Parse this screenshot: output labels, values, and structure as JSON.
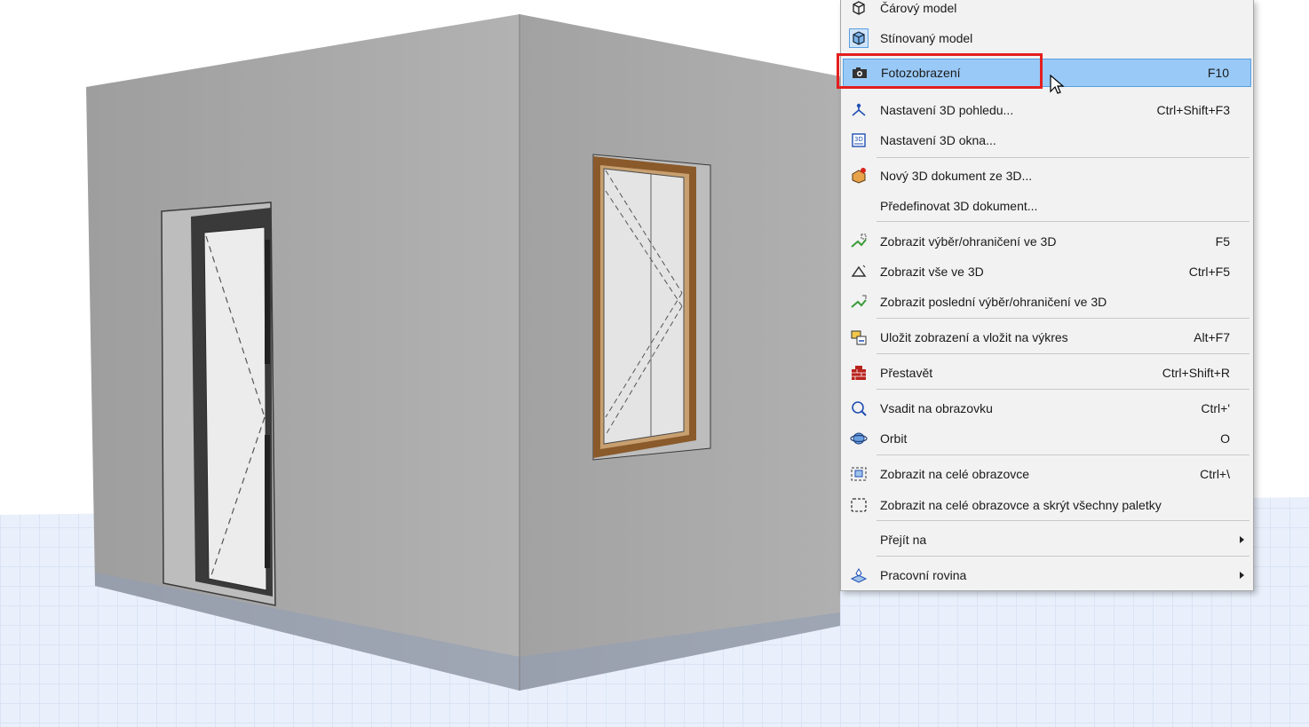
{
  "menu": {
    "items": [
      {
        "label": "Čárový model",
        "shortcut": "",
        "icon": "wireframe-model-icon"
      },
      {
        "label": "Stínovaný model",
        "shortcut": "",
        "icon": "shaded-model-icon"
      },
      {
        "label": "Fotozobrazení",
        "shortcut": "F10",
        "icon": "camera-icon"
      },
      {
        "label": "Nastavení 3D pohledu...",
        "shortcut": "Ctrl+Shift+F3",
        "icon": "3d-view-settings-icon"
      },
      {
        "label": "Nastavení 3D okna...",
        "shortcut": "",
        "icon": "3d-window-settings-icon"
      },
      {
        "label": "Nový 3D dokument ze 3D...",
        "shortcut": "",
        "icon": "new-3d-document-icon"
      },
      {
        "label": "Předefinovat 3D dokument...",
        "shortcut": "",
        "icon": ""
      },
      {
        "label": "Zobrazit výběr/ohraničení ve 3D",
        "shortcut": "F5",
        "icon": "show-selection-3d-icon"
      },
      {
        "label": "Zobrazit vše ve 3D",
        "shortcut": "Ctrl+F5",
        "icon": "show-all-3d-icon"
      },
      {
        "label": "Zobrazit poslední výběr/ohraničení ve 3D",
        "shortcut": "",
        "icon": "show-last-selection-3d-icon"
      },
      {
        "label": "Uložit zobrazení a vložit na výkres",
        "shortcut": "Alt+F7",
        "icon": "save-view-place-icon"
      },
      {
        "label": "Přestavět",
        "shortcut": "Ctrl+Shift+R",
        "icon": "rebuild-icon"
      },
      {
        "label": "Vsadit na obrazovku",
        "shortcut": "Ctrl+'",
        "icon": "fit-in-window-icon"
      },
      {
        "label": "Orbit",
        "shortcut": "O",
        "icon": "orbit-icon"
      },
      {
        "label": "Zobrazit na celé obrazovce",
        "shortcut": "Ctrl+\\",
        "icon": "full-screen-icon"
      },
      {
        "label": "Zobrazit na celé obrazovce a skrýt všechny paletky",
        "shortcut": "",
        "icon": "full-screen-hide-palettes-icon"
      },
      {
        "label": "Přejít na",
        "shortcut": "",
        "icon": ""
      },
      {
        "label": "Pracovní rovina",
        "shortcut": "",
        "icon": "editing-plane-icon"
      }
    ]
  },
  "colors": {
    "highlight": "#99c9f7",
    "annotation_red": "#e41e1e",
    "wall": "#a9a9a9",
    "frame_wood": "#8a5a2b"
  }
}
